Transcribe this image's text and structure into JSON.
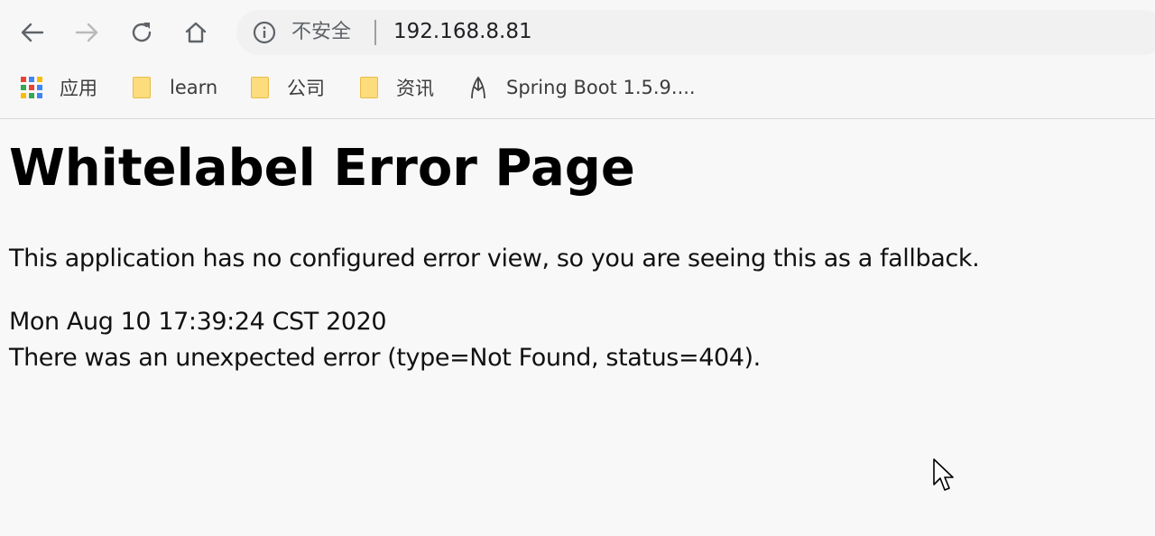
{
  "browser": {
    "security_label": "不安全",
    "url": "192.168.8.81"
  },
  "bookmarks": [
    {
      "label": "应用",
      "icon": "apps-grid-icon"
    },
    {
      "label": "learn",
      "icon": "folder-icon"
    },
    {
      "label": "公司",
      "icon": "folder-icon"
    },
    {
      "label": "资讯",
      "icon": "folder-icon"
    },
    {
      "label": "Spring Boot 1.5.9....",
      "icon": "spring-leaf-icon"
    }
  ],
  "page": {
    "title": "Whitelabel Error Page",
    "intro": "This application has no configured error view, so you are seeing this as a fallback.",
    "timestamp": "Mon Aug 10 17:39:24 CST 2020",
    "error_message": "There was an unexpected error (type=Not Found, status=404)."
  },
  "colors": {
    "page_background": "#f8f8f8",
    "omnibox_background": "#f1f1f1",
    "folder_fill": "#fcdc7c",
    "icon_gray": "#5f6368"
  }
}
